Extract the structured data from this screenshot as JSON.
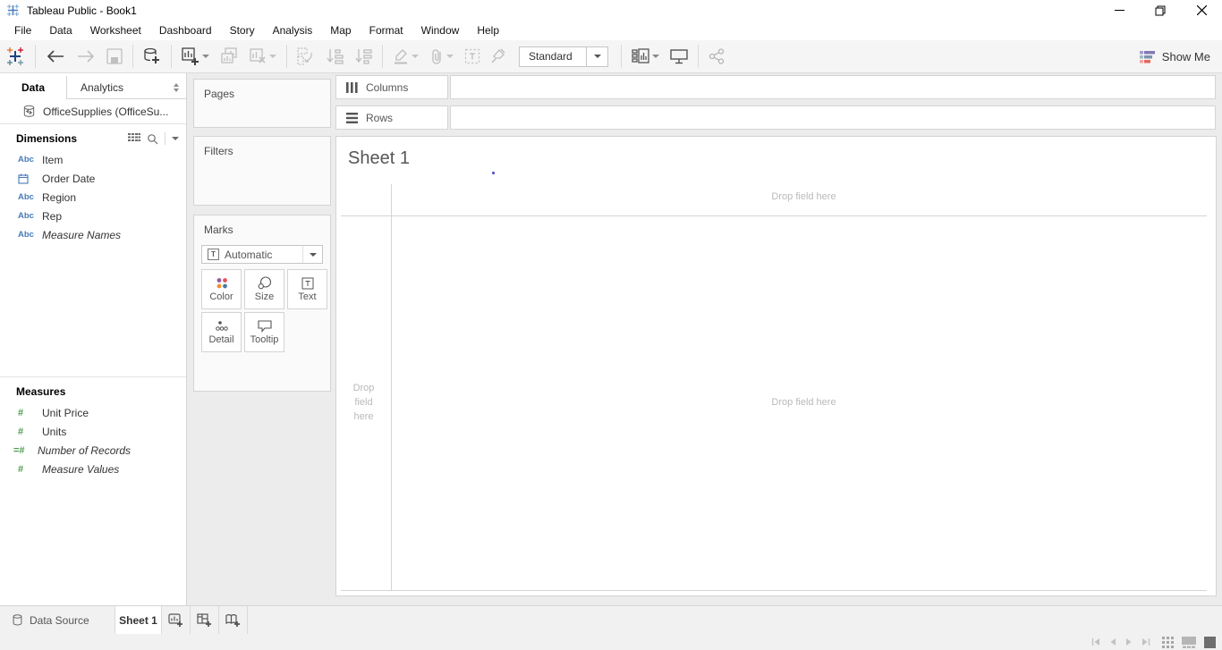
{
  "titlebar": {
    "title": "Tableau Public - Book1"
  },
  "menubar": {
    "items": [
      "File",
      "Data",
      "Worksheet",
      "Dashboard",
      "Story",
      "Analysis",
      "Map",
      "Format",
      "Window",
      "Help"
    ]
  },
  "toolbar": {
    "fit_selector_value": "Standard",
    "show_me_label": "Show Me"
  },
  "icons": {
    "text_field": "Abc",
    "number_field": "#",
    "auto_number_field": "=#",
    "text_mark": "T"
  },
  "sidebar": {
    "tabs": {
      "data": "Data",
      "analytics": "Analytics"
    },
    "datasource_label": "OfficeSupplies (OfficeSu...",
    "dimensions": {
      "title": "Dimensions",
      "fields": [
        {
          "label": "Item",
          "type": "text"
        },
        {
          "label": "Order Date",
          "type": "date"
        },
        {
          "label": "Region",
          "type": "text"
        },
        {
          "label": "Rep",
          "type": "text"
        },
        {
          "label": "Measure Names",
          "type": "text-generated"
        }
      ]
    },
    "measures": {
      "title": "Measures",
      "fields": [
        {
          "label": "Unit Price",
          "type": "number"
        },
        {
          "label": "Units",
          "type": "number"
        },
        {
          "label": "Number of Records",
          "type": "calculated-number-generated"
        },
        {
          "label": "Measure Values",
          "type": "number-generated"
        }
      ]
    }
  },
  "cards": {
    "pages_label": "Pages",
    "filters_label": "Filters",
    "marks": {
      "title": "Marks",
      "mark_type_value": "Automatic",
      "buttons": [
        "Color",
        "Size",
        "Text",
        "Detail",
        "Tooltip"
      ]
    }
  },
  "shelves": {
    "columns_label": "Columns",
    "rows_label": "Rows"
  },
  "canvas": {
    "sheet_title": "Sheet 1",
    "drop_field_columns": "Drop field here",
    "drop_field_rows": "Drop field here",
    "drop_field_main": "Drop field here"
  },
  "bottombar": {
    "datasource_tab": "Data Source",
    "sheet_tab": "Sheet 1"
  },
  "colors": {
    "dimension_blue": "#477bb8",
    "measure_green": "#4f9e4f",
    "mark_color_dots": [
      "#9656a1",
      "#e15759",
      "#f28e2b",
      "#4e79a7"
    ],
    "showme_bars": [
      "#8279b6",
      "#7e93ad",
      "#e8685f"
    ]
  }
}
